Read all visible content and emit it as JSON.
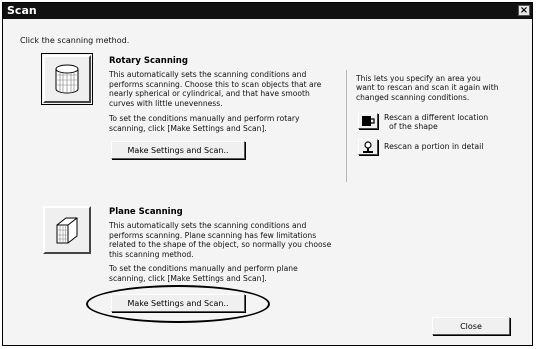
{
  "window": {
    "title": "Scan",
    "close_glyph": "×"
  },
  "instruction": "Click the scanning method.",
  "rotary": {
    "icon": "cylinder-icon",
    "heading": "Rotary Scanning",
    "description": [
      "This automatically sets the scanning conditions and",
      "performs scanning. Choose this to scan objects that are",
      "nearly spherical or cylindrical, and that have smooth",
      "curves with little unevenness."
    ],
    "manual_text": [
      "To set the conditions manually and perform rotary",
      "scanning, click [Make Settings and Scan]."
    ],
    "button_label": "Make Settings and Scan.."
  },
  "plane": {
    "icon": "box-icon",
    "heading": "Plane Scanning",
    "description": [
      "This automatically sets the scanning conditions and",
      "performs scanning. Plane scanning has few limitations",
      "related to the shape of the object, so normally you choose",
      "this scanning method."
    ],
    "manual_text": [
      "To set the conditions manually and perform plane",
      "scanning, click [Make Settings and Scan]."
    ],
    "button_label": "Make Settings and Scan.."
  },
  "rescan": {
    "description": [
      "This lets you specify an area you",
      "want to rescan and scan it again with",
      "changed scanning conditions."
    ],
    "options": [
      {
        "icon": "shape-location-icon",
        "label": [
          "Rescan a different location",
          "of the shape"
        ]
      },
      {
        "icon": "detail-portion-icon",
        "label": [
          "Rescan a portion in detail"
        ]
      }
    ]
  },
  "close_button_label": "Close"
}
